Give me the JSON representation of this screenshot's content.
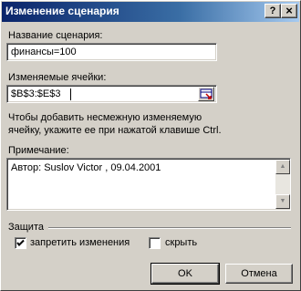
{
  "window": {
    "title": "Изменение сценария",
    "help_label": "?",
    "close_label": "×"
  },
  "scenario_name": {
    "label": "Название сценария:",
    "value": "финансы=100"
  },
  "changing_cells": {
    "label": "Изменяемые ячейки:",
    "value": "$B$3:$E$3",
    "ref_icon": "cell-reference-collapse-icon"
  },
  "hint": {
    "line1": "Чтобы добавить несмежную изменяемую",
    "line2": "ячейку, укажите ее при нажатой клавише Ctrl."
  },
  "comment": {
    "label": "Примечание:",
    "value": "Автор: Suslov Victor , 09.04.2001"
  },
  "protection": {
    "group_label": "Защита",
    "prevent_changes_label": "запретить изменения",
    "prevent_changes_checked": true,
    "hide_label": "скрыть",
    "hide_checked": false
  },
  "buttons": {
    "ok_label": "OK",
    "cancel_label": "Отмена"
  }
}
